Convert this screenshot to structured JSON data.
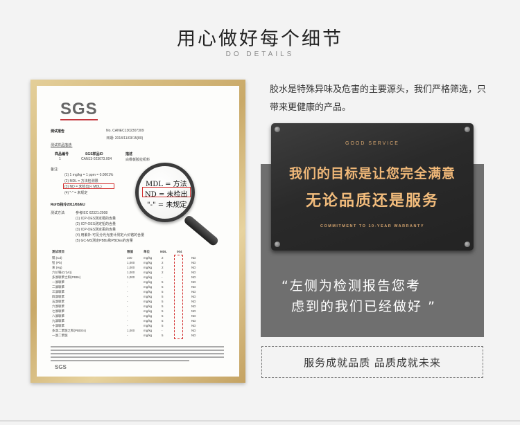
{
  "header": {
    "title": "用心做好每个细节",
    "subtitle": "DO DETAILS"
  },
  "certificate": {
    "logo": "SGS",
    "report_label": "测试报告",
    "report_no": "No. CANEC1302307309",
    "date": "日期: 2018/11/03/15(80)",
    "sample_label": "测试样品描述:",
    "col_sample_no": "样品编号",
    "col_sgs_id": "SGS样品ID",
    "col_desc": "描述",
    "row_no": "1",
    "row_id": "CAN13-023073.004",
    "row_desc": "白橡板胶拉机料",
    "note_label": "备注:",
    "note1": "(1) 1 mg/kg = 1 ppm = 0.0001%",
    "note2": "(2) MDL = 方法检测限",
    "note3": "(3) ND = 未检出(< MDL)",
    "note4": "(4) \"-\" = 未规定",
    "rohs": "RoHS指令2011/65/EU",
    "method_label": "测试方法:",
    "method1": "参考IEC 62321:2008",
    "method2": "(1) ICP-OES测定镉的含量",
    "method3": "(2) ICP-OES测定铅的含量",
    "method4": "(3) ICP-OES测定汞的含量",
    "method5": "(4) 用紫外-可见分光光度计测定六价铬的含量",
    "method6": "(5) GC-MS测定PBBs和PBDEs的含量",
    "tbl_head_item": "测试项目",
    "tbl_head_limit": "限值",
    "tbl_head_unit": "单位",
    "tbl_head_mdl": "MDL",
    "tbl_head_result": "004",
    "rows": [
      {
        "item": "镉 (Cd)",
        "limit": "100",
        "unit": "mg/kg",
        "mdl": "2",
        "result": "ND"
      },
      {
        "item": "铅 (Pb)",
        "limit": "1,000",
        "unit": "mg/kg",
        "mdl": "2",
        "result": "ND"
      },
      {
        "item": "汞 (Hg)",
        "limit": "1,000",
        "unit": "mg/kg",
        "mdl": "2",
        "result": "ND"
      },
      {
        "item": "六价铬(Cr(VI))",
        "limit": "1,000",
        "unit": "mg/kg",
        "mdl": "2",
        "result": "ND"
      },
      {
        "item": "多溴联苯之和(PBBs)",
        "limit": "1,000",
        "unit": "mg/kg",
        "mdl": "-",
        "result": "ND"
      },
      {
        "item": "一溴联苯",
        "limit": "-",
        "unit": "mg/kg",
        "mdl": "5",
        "result": "ND"
      },
      {
        "item": "二溴联苯",
        "limit": "-",
        "unit": "mg/kg",
        "mdl": "5",
        "result": "ND"
      },
      {
        "item": "三溴联苯",
        "limit": "-",
        "unit": "mg/kg",
        "mdl": "5",
        "result": "ND"
      },
      {
        "item": "四溴联苯",
        "limit": "-",
        "unit": "mg/kg",
        "mdl": "5",
        "result": "ND"
      },
      {
        "item": "五溴联苯",
        "limit": "-",
        "unit": "mg/kg",
        "mdl": "5",
        "result": "ND"
      },
      {
        "item": "六溴联苯",
        "limit": "-",
        "unit": "mg/kg",
        "mdl": "5",
        "result": "ND"
      },
      {
        "item": "七溴联苯",
        "limit": "-",
        "unit": "mg/kg",
        "mdl": "5",
        "result": "ND"
      },
      {
        "item": "八溴联苯",
        "limit": "-",
        "unit": "mg/kg",
        "mdl": "5",
        "result": "ND"
      },
      {
        "item": "九溴联苯",
        "limit": "-",
        "unit": "mg/kg",
        "mdl": "5",
        "result": "ND"
      },
      {
        "item": "十溴联苯",
        "limit": "-",
        "unit": "mg/kg",
        "mdl": "5",
        "result": "ND"
      },
      {
        "item": "多溴二苯醚之和(PBDEs)",
        "limit": "1,000",
        "unit": "mg/kg",
        "mdl": "-",
        "result": "ND"
      },
      {
        "item": "一溴二苯醚",
        "limit": "-",
        "unit": "mg/kg",
        "mdl": "5",
        "result": "ND"
      }
    ],
    "stamp": "SGS"
  },
  "magnifier": {
    "line1": "MDL = 方法",
    "line2": "ND = 未检出",
    "line3": "\"-\" = 未规定"
  },
  "description": "胶水是特殊异味及危害的主要源头，我们严格筛选，只带来更健康的产品。",
  "sign": {
    "top": "GOOD SERVICE",
    "line1": "我们的目标是让您完全满意",
    "line2": "无论品质还是服务",
    "bottom": "COMMITMENT TO 10-YEAR WARRANTY"
  },
  "quote": {
    "open": "“",
    "line1": "左侧为检测报告您考",
    "line2": "虑到的我们已经做好",
    "close": "”"
  },
  "motto": "服务成就品质 品质成就未来"
}
